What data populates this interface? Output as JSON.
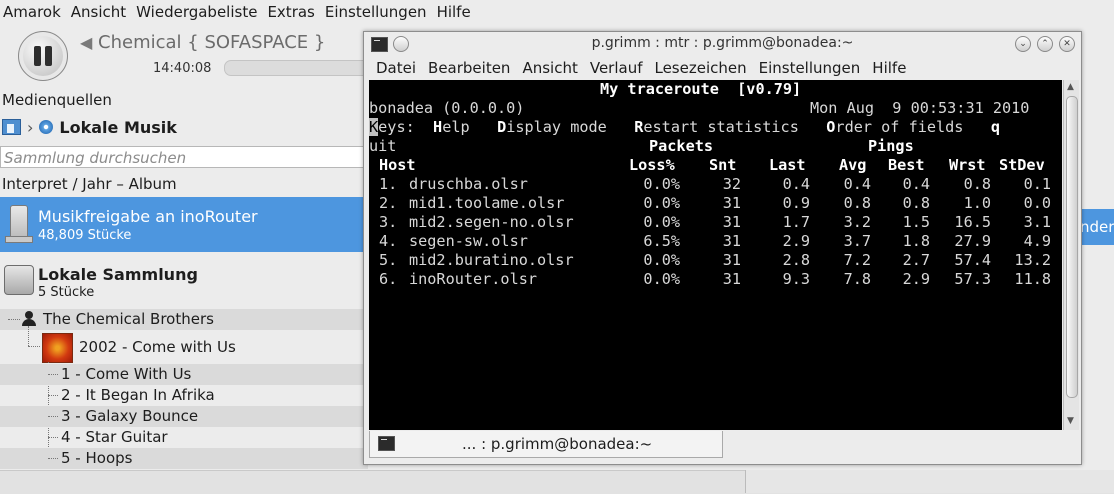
{
  "amarok": {
    "menu": [
      "Amarok",
      "Ansicht",
      "Wiedergabeliste",
      "Extras",
      "Einstellungen",
      "Hilfe"
    ],
    "track": "Chemical  { SOFASPACE }",
    "time": "14:40:08"
  },
  "sources": {
    "label": "Medienquellen",
    "breadcrumb": "Lokale Musik",
    "search_placeholder": "Sammlung durchsuchen",
    "sort_label": "Interpret / Jahr – Album",
    "collections": [
      {
        "title": "Musikfreigabe an inoRouter",
        "count": "48,809 Stücke"
      },
      {
        "title": "Lokale Sammlung",
        "count": "5 Stücke"
      }
    ],
    "artist": "The Chemical Brothers",
    "album": "2002 - Come with Us",
    "tracks": [
      "1 - Come With Us",
      "2 - It Began In Afrika",
      "3 - Galaxy Bounce",
      "4 - Star Guitar",
      "5 - Hoops"
    ]
  },
  "right_peek": "nder",
  "konsole": {
    "title": "p.grimm : mtr : p.grimm@bonadea:~",
    "menu": [
      "Datei",
      "Bearbeiten",
      "Ansicht",
      "Verlauf",
      "Lesezeichen",
      "Einstellungen",
      "Hilfe"
    ],
    "tab_label": "... : p.grimm@bonadea:~",
    "mtr": {
      "heading": "My traceroute  [v0.79]",
      "host": "bonadea (0.0.0.0)",
      "date": "Mon Aug  9 00:53:31 2010",
      "keys_line": "Keys:  Help   Display mode   Restart statistics   Order of fields   q",
      "keys_line2": "uit",
      "group_packets": "Packets",
      "group_pings": "Pings",
      "columns": [
        "Host",
        "Loss%",
        "Snt",
        "Last",
        "Avg",
        "Best",
        "Wrst",
        "StDev"
      ],
      "rows": [
        {
          "n": "1.",
          "host": "druschba.olsr",
          "loss": "0.0%",
          "snt": "32",
          "last": "0.4",
          "avg": "0.4",
          "best": "0.4",
          "wrst": "0.8",
          "stdev": "0.1"
        },
        {
          "n": "2.",
          "host": "mid1.toolame.olsr",
          "loss": "0.0%",
          "snt": "31",
          "last": "0.9",
          "avg": "0.8",
          "best": "0.8",
          "wrst": "1.0",
          "stdev": "0.0"
        },
        {
          "n": "3.",
          "host": "mid2.segen-no.olsr",
          "loss": "0.0%",
          "snt": "31",
          "last": "1.7",
          "avg": "3.2",
          "best": "1.5",
          "wrst": "16.5",
          "stdev": "3.1"
        },
        {
          "n": "4.",
          "host": "segen-sw.olsr",
          "loss": "6.5%",
          "snt": "31",
          "last": "2.9",
          "avg": "3.7",
          "best": "1.8",
          "wrst": "27.9",
          "stdev": "4.9"
        },
        {
          "n": "5.",
          "host": "mid2.buratino.olsr",
          "loss": "0.0%",
          "snt": "31",
          "last": "2.8",
          "avg": "7.2",
          "best": "2.7",
          "wrst": "57.4",
          "stdev": "13.2"
        },
        {
          "n": "6.",
          "host": "inoRouter.olsr",
          "loss": "0.0%",
          "snt": "31",
          "last": "9.3",
          "avg": "7.8",
          "best": "2.9",
          "wrst": "57.3",
          "stdev": "11.8"
        }
      ]
    }
  }
}
